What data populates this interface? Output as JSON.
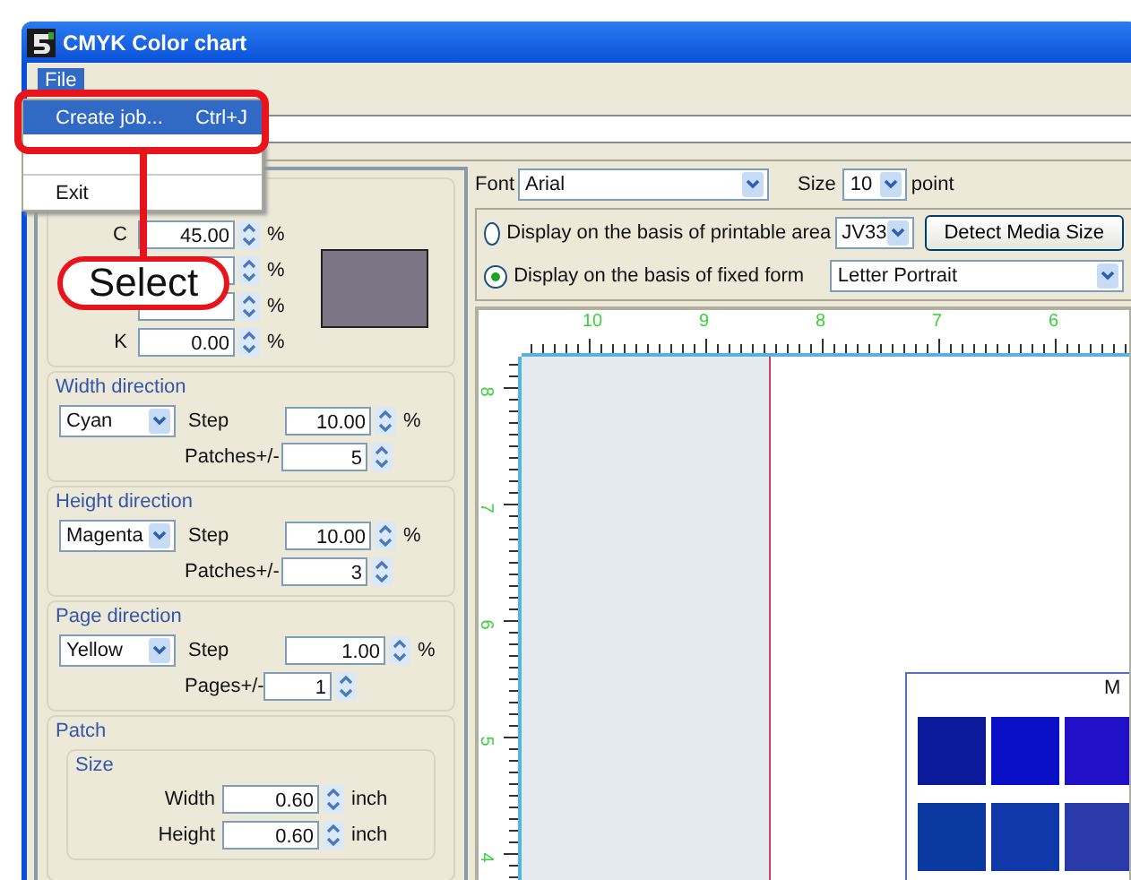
{
  "window": {
    "title": "CMYK Color chart"
  },
  "menu_bar": [
    "File"
  ],
  "file_menu": [
    {
      "label": "Create job...",
      "shortcut": "Ctrl+J",
      "selected": true
    },
    {
      "label": "Exit",
      "selected": false
    }
  ],
  "callout": {
    "text": "Select"
  },
  "color": {
    "rows": [
      {
        "label": "C",
        "value": "45.00",
        "unit": "%"
      },
      {
        "unit": "%"
      },
      {
        "unit": "%"
      },
      {
        "label": "K",
        "value": "0.00",
        "unit": "%"
      }
    ]
  },
  "directions": [
    {
      "title": "Width direction",
      "channel": "Cyan",
      "step_label": "Step",
      "step": "10.00",
      "unit": "%",
      "count_label": "Patches+/-",
      "count": "5"
    },
    {
      "title": "Height direction",
      "channel": "Magenta",
      "step_label": "Step",
      "step": "10.00",
      "unit": "%",
      "count_label": "Patches+/-",
      "count": "3"
    },
    {
      "title": "Page direction",
      "channel": "Yellow",
      "step_label": "Step",
      "step": "1.00",
      "unit": "%",
      "count_label": "Pages+/-",
      "count": "1"
    }
  ],
  "patch": {
    "title": "Patch",
    "size": {
      "title": "Size",
      "rows": [
        {
          "label": "Width",
          "value": "0.60",
          "unit": "inch"
        },
        {
          "label": "Height",
          "value": "0.60",
          "unit": "inch"
        }
      ]
    }
  },
  "font": {
    "label": "Font",
    "value": "Arial",
    "size_label": "Size",
    "size": "10",
    "size_unit": "point"
  },
  "display": {
    "options": [
      {
        "label": "Display on the basis of printable area",
        "selected": false
      },
      {
        "label": "Display on the basis of fixed form",
        "selected": true
      }
    ],
    "printer": "JV33",
    "detect_button": "Detect Media Size",
    "form": "Letter Portrait"
  },
  "rulers": {
    "horizontal": [
      "10",
      "9",
      "8",
      "7",
      "6"
    ],
    "vertical": [
      "8",
      "7",
      "6",
      "5",
      "4"
    ]
  },
  "preview": {
    "title": "M",
    "patches": [
      {
        "color": "#0a1a9a"
      },
      {
        "color": "#0a10c8"
      },
      {
        "color": "#2010c8"
      },
      {
        "color": "#0a3aa0"
      },
      {
        "color": "#1038a8"
      },
      {
        "color": "#2a3aa8"
      }
    ]
  }
}
